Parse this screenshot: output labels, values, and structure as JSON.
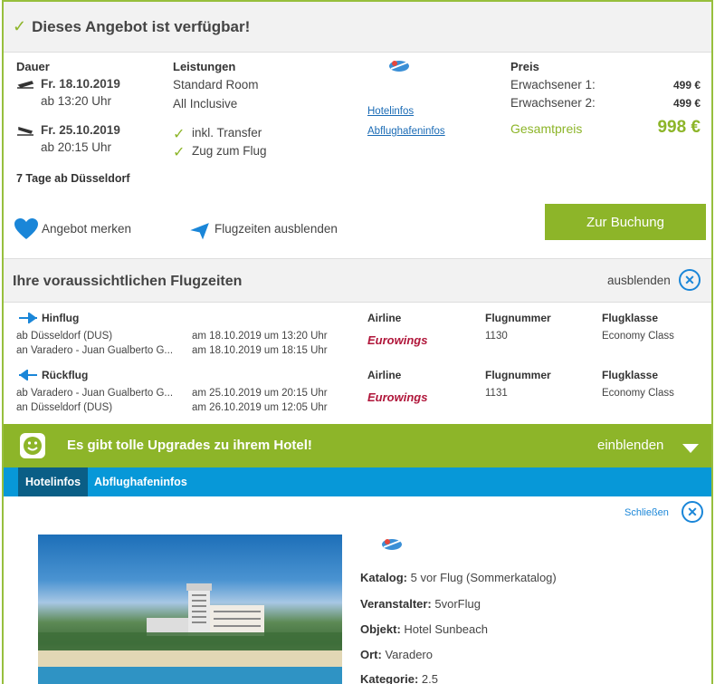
{
  "header": {
    "title": "Dieses Angebot ist verfügbar!"
  },
  "overview": {
    "duration_label": "Dauer",
    "outbound_date": "Fr. 18.10.2019",
    "outbound_time": "ab 13:20 Uhr",
    "return_date": "Fr. 25.10.2019",
    "return_time": "ab 20:15 Uhr",
    "summary": "7 Tage ab Düsseldorf",
    "services_label": "Leistungen",
    "room": "Standard Room",
    "board": "All Inclusive",
    "extra1": "inkl. Transfer",
    "extra2": "Zug zum Flug",
    "hotelinfo_link": "Hotelinfos",
    "airportinfo_link": "Abflughafeninfos",
    "price_label": "Preis",
    "adult1_label": "Erwachsener 1:",
    "adult1_price": "499 €",
    "adult2_label": "Erwachsener 2:",
    "adult2_price": "499 €",
    "total_label": "Gesamtpreis",
    "total_price": "998 €",
    "remember": "Angebot merken",
    "hide_flights": "Flugzeiten ausblenden",
    "book": "Zur Buchung"
  },
  "flights": {
    "title": "Ihre voraussichtlichen Flugzeiten",
    "hide": "ausblenden",
    "legs": [
      {
        "label": "Hinflug",
        "from": "ab Düsseldorf (DUS)",
        "to": "an Varadero - Juan Gualberto G...",
        "dep": "am 18.10.2019 um 13:20 Uhr",
        "arr": "am 18.10.2019 um 18:15 Uhr",
        "airline_label": "Airline",
        "airline": "Eurowings",
        "flightno_label": "Flugnummer",
        "flightno": "1130",
        "class_label": "Flugklasse",
        "class": "Economy Class"
      },
      {
        "label": "Rückflug",
        "from": "ab Varadero - Juan Gualberto G...",
        "to": "an Düsseldorf (DUS)",
        "dep": "am 25.10.2019 um 20:15 Uhr",
        "arr": "am 26.10.2019 um 12:05 Uhr",
        "airline_label": "Airline",
        "airline": "Eurowings",
        "flightno_label": "Flugnummer",
        "flightno": "1131",
        "class_label": "Flugklasse",
        "class": "Economy Class"
      }
    ]
  },
  "upgrade": {
    "text": "Es gibt tolle Upgrades zu ihrem Hotel!",
    "action": "einblenden"
  },
  "tabs": [
    "Hotelinfos",
    "Abflughafeninfos"
  ],
  "hotel": {
    "close": "Schließen",
    "details": [
      {
        "k": "Katalog:",
        "v": "5 vor Flug (Sommerkatalog)"
      },
      {
        "k": "Veranstalter:",
        "v": "5vorFlug"
      },
      {
        "k": "Objekt:",
        "v": "Hotel Sunbeach"
      },
      {
        "k": "Ort:",
        "v": "Varadero"
      },
      {
        "k": "Kategorie:",
        "v": "2.5"
      }
    ]
  },
  "colors": {
    "accent": "#8db529",
    "blue": "#0798d8",
    "eurowings": "#b0163a"
  }
}
